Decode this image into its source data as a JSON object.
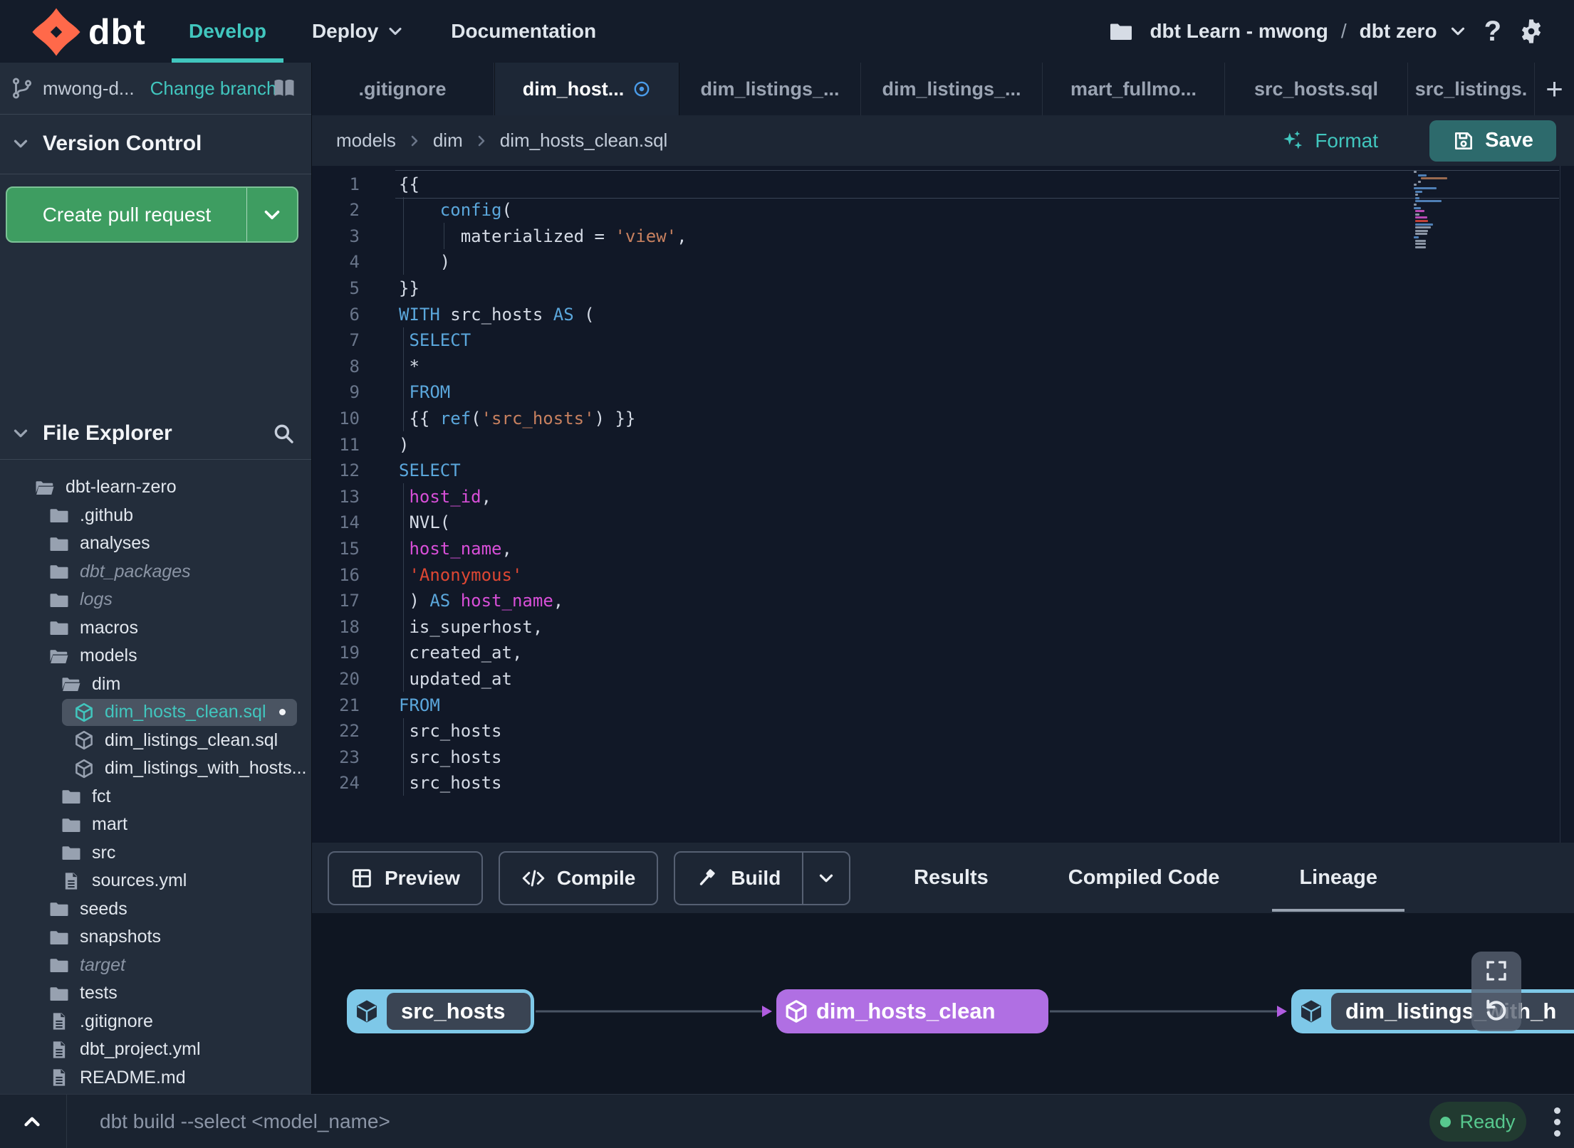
{
  "colors": {
    "accent": "#41C6BE",
    "green": "#3E9D61",
    "save": "#2D6A6C",
    "purple": "#B06FE3",
    "node_blue": "#7EC8E8",
    "ready": "#57C88E",
    "modified_blue": "#4A9BE8",
    "kw": "#5BA7DC",
    "str": "#C7805F",
    "strred": "#DE4733",
    "field": "#D84FD8"
  },
  "navbar": {
    "brand": "dbt",
    "items": [
      {
        "label": "Develop",
        "active": true
      },
      {
        "label": "Deploy",
        "chevron": true
      },
      {
        "label": "Documentation"
      }
    ],
    "project": {
      "account": "dbt Learn - mwong",
      "separator": "/",
      "name": "dbt zero"
    }
  },
  "sidebar": {
    "branch": {
      "name": "mwong-d...",
      "change_label": "Change branch"
    },
    "version_control": {
      "title": "Version Control",
      "create_pr_label": "Create pull request"
    },
    "file_explorer": {
      "title": "File Explorer",
      "tree": [
        {
          "label": "dbt-learn-zero",
          "type": "folder-open",
          "level": 0
        },
        {
          "label": ".github",
          "type": "folder",
          "level": 1
        },
        {
          "label": "analyses",
          "type": "folder",
          "level": 1
        },
        {
          "label": "dbt_packages",
          "type": "folder",
          "level": 1,
          "dim": true
        },
        {
          "label": "logs",
          "type": "folder",
          "level": 1,
          "dim": true
        },
        {
          "label": "macros",
          "type": "folder",
          "level": 1
        },
        {
          "label": "models",
          "type": "folder-open",
          "level": 1
        },
        {
          "label": "dim",
          "type": "folder-open",
          "level": 2
        },
        {
          "label": "dim_hosts_clean.sql",
          "type": "model",
          "level": 3,
          "selected": true,
          "modified": true
        },
        {
          "label": "dim_listings_clean.sql",
          "type": "model",
          "level": 3
        },
        {
          "label": "dim_listings_with_hosts...",
          "type": "model",
          "level": 3
        },
        {
          "label": "fct",
          "type": "folder",
          "level": 2
        },
        {
          "label": "mart",
          "type": "folder",
          "level": 2
        },
        {
          "label": "src",
          "type": "folder",
          "level": 2
        },
        {
          "label": "sources.yml",
          "type": "file",
          "level": 2
        },
        {
          "label": "seeds",
          "type": "folder",
          "level": 1
        },
        {
          "label": "snapshots",
          "type": "folder",
          "level": 1
        },
        {
          "label": "target",
          "type": "folder",
          "level": 1,
          "dim": true
        },
        {
          "label": "tests",
          "type": "folder",
          "level": 1
        },
        {
          "label": ".gitignore",
          "type": "file",
          "level": 1
        },
        {
          "label": "dbt_project.yml",
          "type": "file",
          "level": 1
        },
        {
          "label": "README.md",
          "type": "file",
          "level": 1
        }
      ]
    }
  },
  "tabs": {
    "items": [
      {
        "label": ".gitignore"
      },
      {
        "label": "dim_host...",
        "active": true,
        "modified": true
      },
      {
        "label": "dim_listings_..."
      },
      {
        "label": "dim_listings_..."
      },
      {
        "label": "mart_fullmo..."
      },
      {
        "label": "src_hosts.sql"
      },
      {
        "label": "src_listings."
      }
    ],
    "new_tab_label": "+"
  },
  "editor_header": {
    "breadcrumb": [
      "models",
      "dim",
      "dim_hosts_clean.sql"
    ],
    "format_label": "Format",
    "save_label": "Save"
  },
  "editor": {
    "lines": [
      {
        "n": "1",
        "tokens": [
          [
            "{{",
            "d"
          ]
        ]
      },
      {
        "n": "2",
        "tokens": [
          [
            "    ",
            "d"
          ],
          [
            "config",
            "k"
          ],
          [
            "(",
            "d"
          ]
        ]
      },
      {
        "n": "3",
        "tokens": [
          [
            "      materialized = ",
            "d"
          ],
          [
            "'view'",
            "s"
          ],
          [
            ",",
            "d"
          ]
        ]
      },
      {
        "n": "4",
        "tokens": [
          [
            "    )",
            "d"
          ]
        ]
      },
      {
        "n": "5",
        "tokens": [
          [
            "}}",
            "d"
          ]
        ]
      },
      {
        "n": "6",
        "tokens": [
          [
            "WITH",
            "k"
          ],
          [
            " src_hosts ",
            "d"
          ],
          [
            "AS",
            "k"
          ],
          [
            " (",
            "d"
          ]
        ]
      },
      {
        "n": "7",
        "tokens": [
          [
            " ",
            "d"
          ],
          [
            "SELECT",
            "k"
          ]
        ]
      },
      {
        "n": "8",
        "tokens": [
          [
            " *",
            "d"
          ]
        ]
      },
      {
        "n": "9",
        "tokens": [
          [
            " ",
            "d"
          ],
          [
            "FROM",
            "k"
          ]
        ]
      },
      {
        "n": "10",
        "tokens": [
          [
            " {{ ",
            "d"
          ],
          [
            "ref",
            "k"
          ],
          [
            "(",
            "d"
          ],
          [
            "'src_hosts'",
            "s"
          ],
          [
            ") }}",
            "d"
          ]
        ]
      },
      {
        "n": "11",
        "tokens": [
          [
            ")",
            "d"
          ]
        ]
      },
      {
        "n": "12",
        "tokens": [
          [
            "SELECT",
            "k"
          ]
        ]
      },
      {
        "n": "13",
        "tokens": [
          [
            " ",
            "d"
          ],
          [
            "host_id",
            "f"
          ],
          [
            ",",
            "d"
          ]
        ]
      },
      {
        "n": "14",
        "tokens": [
          [
            " NVL(",
            "d"
          ]
        ]
      },
      {
        "n": "15",
        "tokens": [
          [
            " ",
            "d"
          ],
          [
            "host_name",
            "f"
          ],
          [
            ",",
            "d"
          ]
        ]
      },
      {
        "n": "16",
        "tokens": [
          [
            " ",
            "d"
          ],
          [
            "'Anonymous'",
            "r"
          ]
        ]
      },
      {
        "n": "17",
        "tokens": [
          [
            " ) ",
            "d"
          ],
          [
            "AS",
            "k"
          ],
          [
            " ",
            "d"
          ],
          [
            "host_name",
            "f"
          ],
          [
            ",",
            "d"
          ]
        ]
      },
      {
        "n": "18",
        "tokens": [
          [
            " is_superhost,",
            "d"
          ]
        ]
      },
      {
        "n": "19",
        "tokens": [
          [
            " created_at,",
            "d"
          ]
        ]
      },
      {
        "n": "20",
        "tokens": [
          [
            " updated_at",
            "d"
          ]
        ]
      },
      {
        "n": "21",
        "tokens": [
          [
            "FROM",
            "k"
          ]
        ]
      },
      {
        "n": "22",
        "tokens": [
          [
            " src_hosts",
            "d"
          ]
        ]
      },
      {
        "n": "23",
        "tokens": [
          [
            " src_hosts",
            "d"
          ]
        ]
      },
      {
        "n": "24",
        "tokens": [
          [
            " src_hosts",
            "d"
          ]
        ]
      }
    ]
  },
  "bottom_panel": {
    "actions": [
      {
        "label": "Preview",
        "icon": "grid"
      },
      {
        "label": "Compile",
        "icon": "code"
      },
      {
        "label": "Build",
        "icon": "hammer",
        "split": true
      }
    ],
    "tabs": [
      {
        "label": "Results"
      },
      {
        "label": "Compiled Code"
      },
      {
        "label": "Lineage",
        "active": true
      }
    ]
  },
  "lineage": {
    "nodes": [
      {
        "label": "src_hosts",
        "style": "source"
      },
      {
        "label": "dim_hosts_clean",
        "style": "selected"
      },
      {
        "label": "dim_listings_with_h",
        "style": "source"
      }
    ]
  },
  "command_bar": {
    "placeholder": "dbt build --select <model_name>",
    "status": "Ready"
  }
}
